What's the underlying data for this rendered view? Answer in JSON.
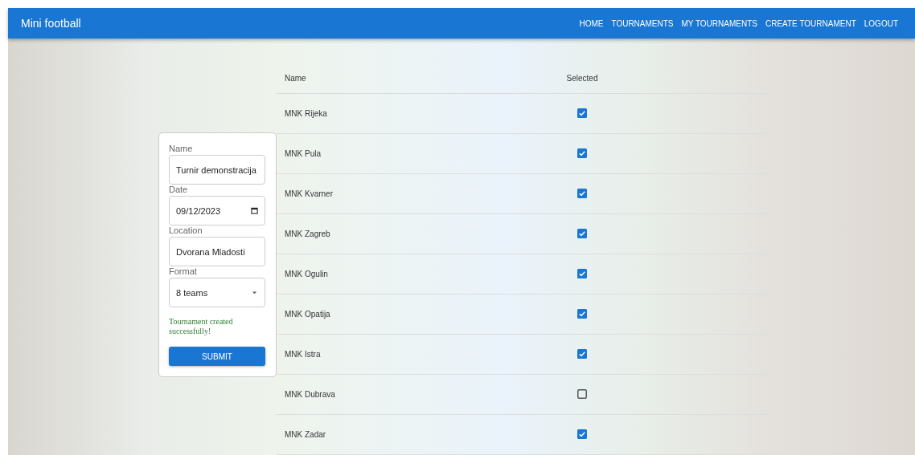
{
  "app_bar": {
    "title": "Mini football",
    "nav": [
      "HOME",
      "TOURNAMENTS",
      "MY TOURNAMENTS",
      "CREATE TOURNAMENT",
      "LOGOUT"
    ]
  },
  "form": {
    "fields": [
      {
        "kind": "text",
        "label": "Name",
        "value": "Turnir demonstracija"
      },
      {
        "kind": "date",
        "label": "Date",
        "value": "09/12/2023"
      },
      {
        "kind": "text",
        "label": "Location",
        "value": "Dvorana Mladosti"
      },
      {
        "kind": "select",
        "label": "Format",
        "value": "8 teams"
      }
    ],
    "message": "Tournament created successfully!",
    "submit": "SUBMIT"
  },
  "table": {
    "columns": [
      "Name",
      "Selected"
    ],
    "rows": [
      {
        "name": "MNK Rijeka",
        "checked": true
      },
      {
        "name": "MNK Pula",
        "checked": true
      },
      {
        "name": "MNK Kvarner",
        "checked": true
      },
      {
        "name": "MNK Zagreb",
        "checked": true
      },
      {
        "name": "MNK Ogulin",
        "checked": true
      },
      {
        "name": "MNK Opatija",
        "checked": true
      },
      {
        "name": "MNK Istra",
        "checked": true
      },
      {
        "name": "MNK Dubrava",
        "checked": false
      },
      {
        "name": "MNK Zadar",
        "checked": true
      }
    ]
  }
}
